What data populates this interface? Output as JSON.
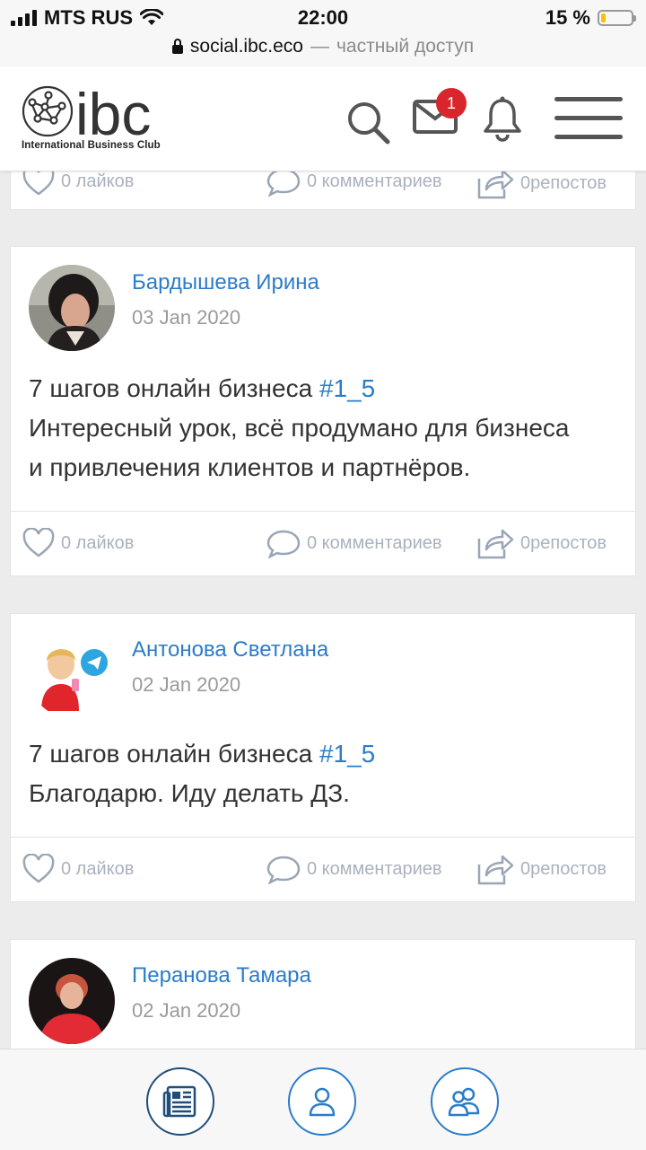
{
  "status_bar": {
    "carrier": "MTS RUS",
    "time": "22:00",
    "battery": "15 %",
    "battery_level": 0.15
  },
  "url_bar": {
    "domain": "social.ibc.eco",
    "separator": "—",
    "status": "частный доступ"
  },
  "header": {
    "logo_text": "ibc",
    "logo_caption": "International Business Club",
    "messages_badge": "1",
    "icons": [
      "search-icon",
      "mail-icon",
      "bell-icon",
      "menu-icon"
    ]
  },
  "top_card": {
    "actions": {
      "likes": "0 лайков",
      "comments": "0 комментариев",
      "reposts": "0репостов"
    }
  },
  "posts": [
    {
      "author": "Бардышева Ирина",
      "date": "03 Jan 2020",
      "title_text": "7 шагов онлайн бизнеса",
      "hashtag": "#1_5",
      "body_lines": [
        "Интересный урок, всё продумано для бизнеса",
        "и привлечения клиентов и партнёров."
      ],
      "actions": {
        "likes": "0 лайков",
        "comments": "0 комментариев",
        "reposts": "0репостов"
      }
    },
    {
      "author": "Антонова Светлана",
      "date": "02 Jan 2020",
      "title_text": "7 шагов онлайн бизнеса",
      "hashtag": "#1_5",
      "body_lines": [
        "Благодарю. Иду делать ДЗ."
      ],
      "actions": {
        "likes": "0 лайков",
        "comments": "0 комментариев",
        "reposts": "0репостов"
      }
    },
    {
      "author": "Перанова Тамара",
      "date": "02 Jan 2020"
    }
  ],
  "bottom_nav": [
    "news-feed-icon",
    "profile-icon",
    "groups-icon"
  ],
  "colors": {
    "link": "#2b7cc9",
    "badge": "#d9262c",
    "action_gray": "#aab2bd",
    "background": "#ececec"
  }
}
